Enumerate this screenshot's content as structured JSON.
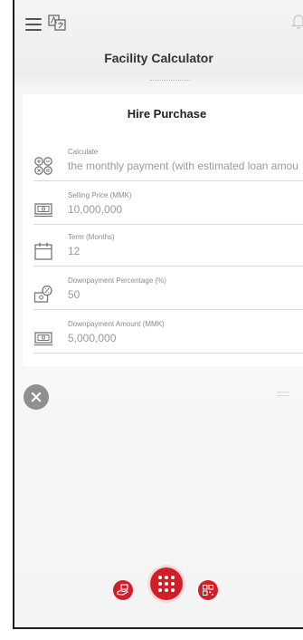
{
  "header": {
    "title": "Facility Calculator"
  },
  "card": {
    "title": "Hire Purchase",
    "fields": [
      {
        "label": "Calculate",
        "value": "the monthly payment (with estimated loan amou",
        "icon": "calculate-icon"
      },
      {
        "label": "Selling Price (MMK)",
        "value": "10,000,000",
        "icon": "money-icon"
      },
      {
        "label": "Term (Months)",
        "value": "12",
        "icon": "calendar-icon"
      },
      {
        "label": "Downpayment Percentage (%)",
        "value": "50",
        "icon": "money-percent-icon"
      },
      {
        "label": "Downpayment Amount (MMK)",
        "value": "5,000,000",
        "icon": "money-icon"
      }
    ]
  },
  "colors": {
    "accent": "#d11f2a",
    "clear_button": "#8f8f8f"
  },
  "nav": {
    "left_icon": "hand-money-icon",
    "center_icon": "apps-grid-icon",
    "right_icon": "qr-code-icon"
  }
}
